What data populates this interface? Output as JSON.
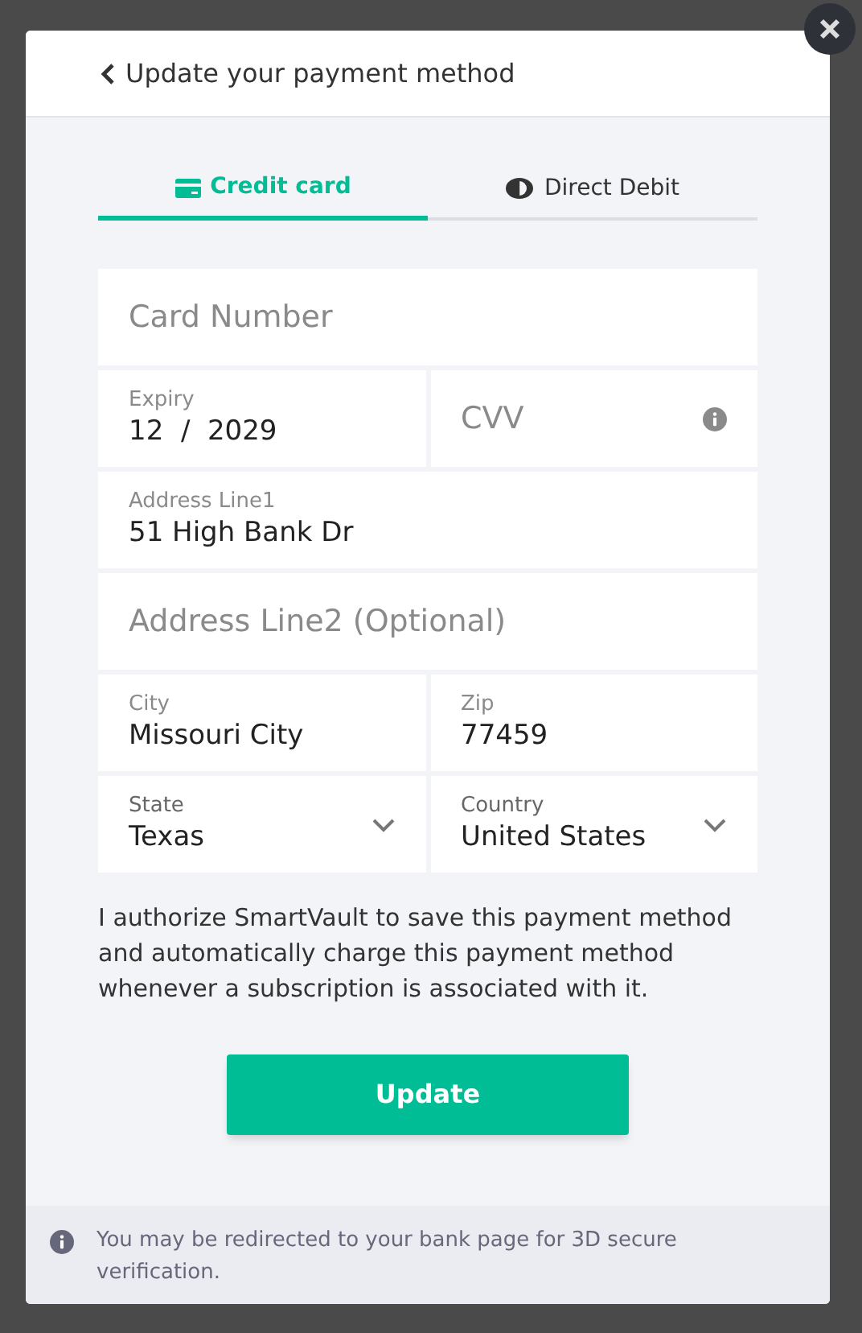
{
  "header": {
    "title": "Update your payment method"
  },
  "tabs": [
    {
      "label": "Credit card",
      "kind": "card",
      "selected": true
    },
    {
      "label": "Direct Debit",
      "kind": "debit",
      "selected": false
    }
  ],
  "form_rows": [
    [
      {
        "kind": "empty",
        "placeholder": "Card Number"
      }
    ],
    [
      {
        "kind": "filled",
        "label": "Expiry",
        "value": "12  /  2029"
      },
      {
        "kind": "empty",
        "placeholder": "CVV",
        "info": true
      }
    ],
    [
      {
        "kind": "filled",
        "label": "Address Line1",
        "value": "51 High Bank Dr"
      }
    ],
    [
      {
        "kind": "empty",
        "placeholder": "Address Line2 (Optional)"
      }
    ],
    [
      {
        "kind": "filled",
        "label": "City",
        "value": "Missouri City"
      },
      {
        "kind": "filled",
        "label": "Zip",
        "value": "77459"
      }
    ],
    [
      {
        "kind": "select",
        "label": "State",
        "value": "Texas"
      },
      {
        "kind": "select",
        "label": "Country",
        "value": "United States"
      }
    ]
  ],
  "consent_text": "I authorize SmartVault to save this payment method and automatically charge this payment method whenever a subscription is associated with it.",
  "submit_button": "Update",
  "footer_note": "You may be redirected to your bank page for 3D secure verification."
}
